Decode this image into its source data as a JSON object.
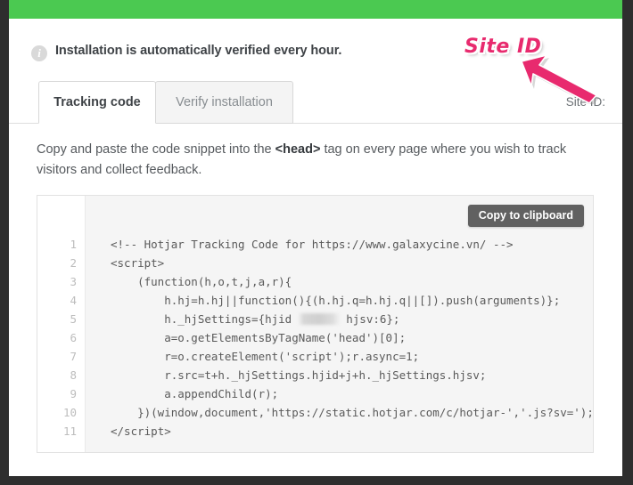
{
  "window": {
    "accent_green": "#4bc951",
    "annotation_color": "#E82A6E",
    "chrome_color": "#2e2e2e"
  },
  "header": {
    "info_icon": "info-icon",
    "info_glyph": "i",
    "notice": "Installation is automatically verified every hour."
  },
  "annotation": {
    "label": "Site ID",
    "arrow": "arrow-up-left-icon"
  },
  "site_id": {
    "label": "Site ID:",
    "value": ""
  },
  "tabs": [
    {
      "label": "Tracking code",
      "active": true
    },
    {
      "label": "Verify installation",
      "active": false
    }
  ],
  "instructions": {
    "part1": "Copy and paste the code snippet into the ",
    "tag": "<head>",
    "part2": " tag on every page where you wish to track visitors and collect feedback."
  },
  "code_panel": {
    "copy_button": "Copy to clipboard",
    "line_numbers": "1\n2\n3\n4\n5\n6\n7\n8\n9\n10\n11",
    "lines_before_redaction": "<!-- Hotjar Tracking Code for https://www.galaxycine.vn/ -->\n<script>\n    (function(h,o,t,j,a,r){\n        h.hj=h.hj||function(){(h.hj.q=h.hj.q||[]).push(arguments)};\n        h._hjSettings={hjid ",
    "redacted_label": "redacted-site-id",
    "lines_after_redaction": " hjsv:6};\n        a=o.getElementsByTagName('head')[0];\n        r=o.createElement('script');r.async=1;\n        r.src=t+h._hjSettings.hjid+j+h._hjSettings.hjsv;\n        a.appendChild(r);\n    })(window,document,'https://static.hotjar.com/c/hotjar-','.js?sv=');\n</scr"
  },
  "code_panel_tail": "ipt>"
}
